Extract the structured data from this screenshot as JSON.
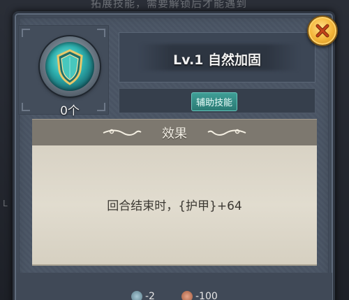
{
  "background": {
    "title_text": "拓展技能，需要解锁后才能遇到",
    "left_letter": "L"
  },
  "skill": {
    "icon_name": "shield-icon",
    "count": "0个",
    "title": "Lv.1 自然加固",
    "type_badge": "辅助技能"
  },
  "effect": {
    "header": "效果",
    "description": "回合结束时，{护甲}+64"
  },
  "cost": {
    "item1": "-2",
    "item2": "-100"
  },
  "close": {
    "icon": "close-icon"
  },
  "colors": {
    "panel": "#4a5565",
    "badge": "#2b7a74",
    "close_button": "#f4b63a",
    "parchment": "#ddd7ca"
  }
}
